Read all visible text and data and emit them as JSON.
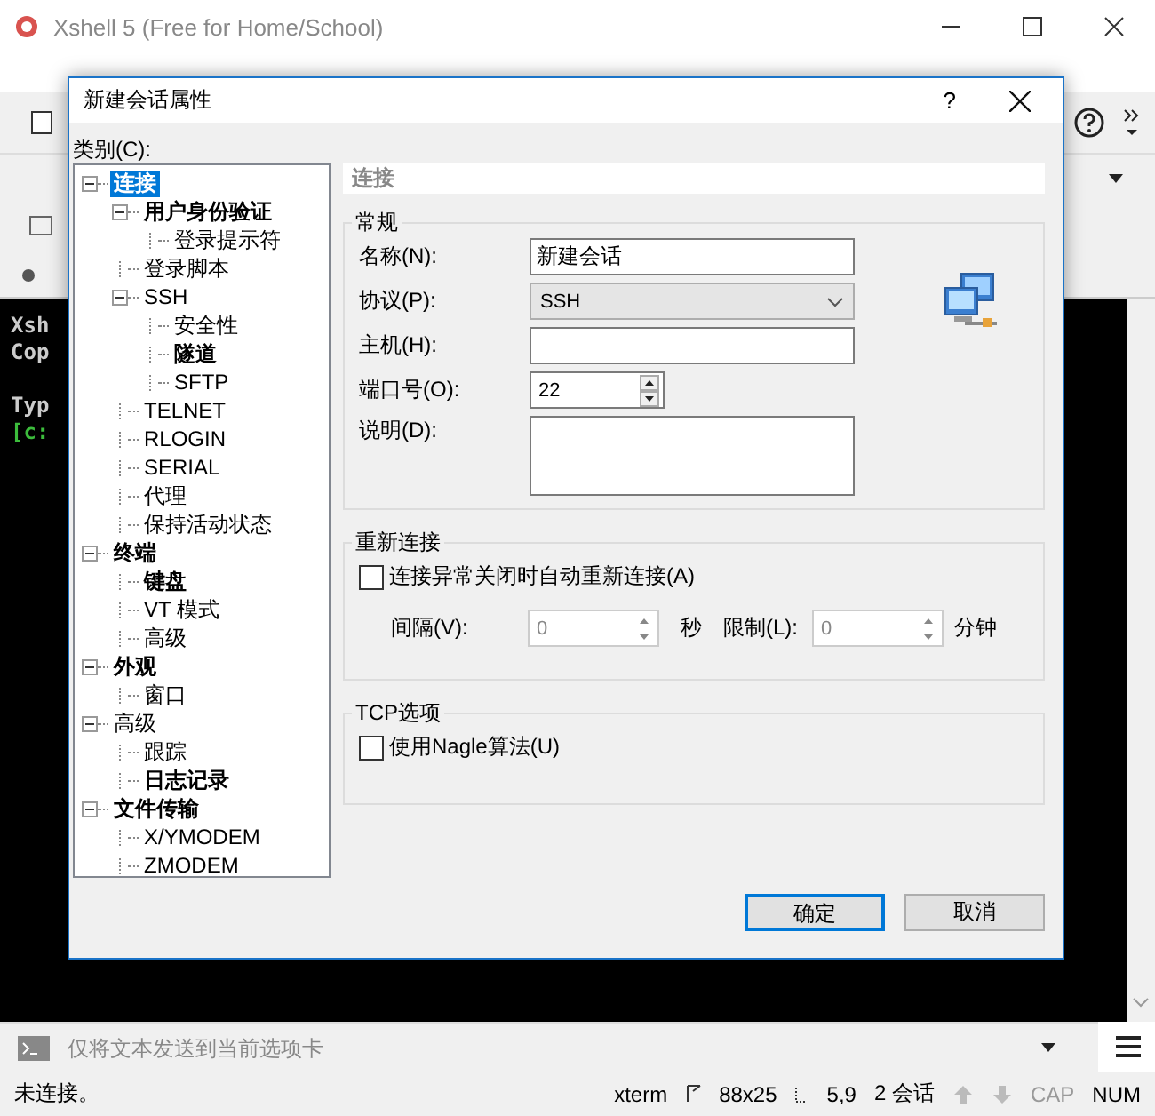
{
  "window": {
    "title": "Xshell 5 (Free for Home/School)"
  },
  "terminal_lines": [
    {
      "text": "Xsh",
      "kind": "plain"
    },
    {
      "text": "Cop",
      "kind": "plain"
    },
    {
      "kind": "blank"
    },
    {
      "text": "Typ",
      "kind": "plain"
    },
    {
      "text": "[c:",
      "kind": "prompt"
    }
  ],
  "dialog": {
    "title": "新建会话属性",
    "help": "?",
    "category_label": "类别(C):",
    "tree": [
      {
        "label": "连接",
        "bold": true,
        "selected": true,
        "expanded": true,
        "children": [
          {
            "label": "用户身份验证",
            "bold": true,
            "selected": false,
            "expanded": true,
            "children": [
              {
                "label": "登录提示符",
                "bold": false,
                "selected": false
              }
            ]
          },
          {
            "label": "登录脚本",
            "bold": false,
            "selected": false
          },
          {
            "label": "SSH",
            "bold": false,
            "selected": false,
            "expanded": true,
            "children": [
              {
                "label": "安全性",
                "bold": false,
                "selected": false
              },
              {
                "label": "隧道",
                "bold": true,
                "selected": false
              },
              {
                "label": "SFTP",
                "bold": false,
                "selected": false
              }
            ]
          },
          {
            "label": "TELNET",
            "bold": false,
            "selected": false
          },
          {
            "label": "RLOGIN",
            "bold": false,
            "selected": false
          },
          {
            "label": "SERIAL",
            "bold": false,
            "selected": false
          },
          {
            "label": "代理",
            "bold": false,
            "selected": false
          },
          {
            "label": "保持活动状态",
            "bold": false,
            "selected": false
          }
        ]
      },
      {
        "label": "终端",
        "bold": true,
        "selected": false,
        "expanded": true,
        "children": [
          {
            "label": "键盘",
            "bold": true,
            "selected": false
          },
          {
            "label": "VT 模式",
            "bold": false,
            "selected": false
          },
          {
            "label": "高级",
            "bold": false,
            "selected": false
          }
        ]
      },
      {
        "label": "外观",
        "bold": true,
        "selected": false,
        "expanded": true,
        "children": [
          {
            "label": "窗口",
            "bold": false,
            "selected": false
          }
        ]
      },
      {
        "label": "高级",
        "bold": false,
        "selected": false,
        "expanded": true,
        "children": [
          {
            "label": "跟踪",
            "bold": false,
            "selected": false
          },
          {
            "label": "日志记录",
            "bold": true,
            "selected": false
          }
        ]
      },
      {
        "label": "文件传输",
        "bold": true,
        "selected": false,
        "expanded": true,
        "children": [
          {
            "label": "X/YMODEM",
            "bold": false,
            "selected": false
          },
          {
            "label": "ZMODEM",
            "bold": false,
            "selected": false
          }
        ]
      }
    ],
    "panel_title": "连接",
    "general": {
      "title": "常规",
      "name_label": "名称(N):",
      "name_value": "新建会话",
      "protocol_label": "协议(P):",
      "protocol_value": "SSH",
      "host_label": "主机(H):",
      "port_label": "端口号(O):",
      "port_value": "22",
      "description_label": "说明(D):"
    },
    "reconnect": {
      "title": "重新连接",
      "checkbox": {
        "label": "连接异常关闭时自动重新连接(A)",
        "checked": false
      },
      "interval_label": "间隔(V):",
      "interval_value": "0",
      "interval_unit": "秒",
      "limit_label": "限制(L):",
      "limit_value": "0",
      "limit_unit": "分钟",
      "disabled": true
    },
    "tcp": {
      "title": "TCP选项",
      "checkbox": {
        "label": "使用Nagle算法(U)",
        "checked": false
      }
    },
    "buttons": [
      {
        "label": "确定",
        "default": true
      },
      {
        "label": "取消",
        "default": false
      }
    ]
  },
  "send_bar": {
    "placeholder": "仅将文本发送到当前选项卡"
  },
  "status_bar": {
    "message": "未连接。",
    "terminal": "xterm",
    "size": "88x25",
    "cursor": "5,9",
    "sessions": "2 会话",
    "indicators": [
      {
        "label": "CAP",
        "on": false
      },
      {
        "label": "NUM",
        "on": true
      }
    ]
  }
}
